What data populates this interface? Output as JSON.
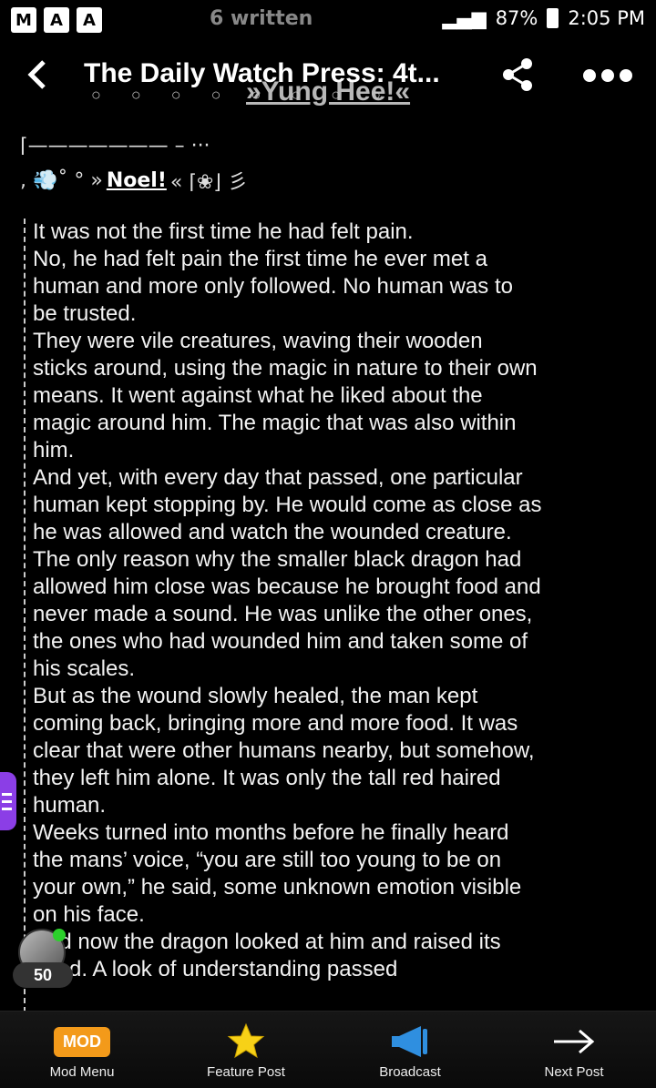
{
  "statusbar": {
    "center_text": "6 written",
    "battery": "87%",
    "time": "2:05 PM"
  },
  "header": {
    "title": "The Daily Watch Press: 4t...",
    "overlay_text": "»Yung Hee!«",
    "circles": "○ ○ ○ ○ ○ ○ ○ ○"
  },
  "content": {
    "deco_line1": "⌈——————— – ···",
    "deco_prefix": ", 💨˚ ° »",
    "deco_name": "Noel!",
    "deco_suffix": "« ⌈❀⌋ 彡",
    "paragraphs": [
      "It was not the first time he had felt pain.",
      "No, he had felt pain the first time he ever met a human and more only followed. No human was to be trusted.",
      "They were vile creatures, waving their wooden sticks around, using the magic in nature to their own means. It went against what he liked about the magic around him. The magic that was also within him.",
      "And yet, with every day that passed, one particular human kept stopping by. He would come as close as he was allowed and watch the wounded creature.",
      "The only reason why the smaller black dragon had allowed him close was because he brought food and never made a sound. He was unlike the other ones, the ones who had wounded him and taken some of his scales.",
      "But as the wound slowly healed, the man kept coming back, bringing more and more food. It was clear that were other humans nearby, but somehow, they left him alone. It was only the tall red haired human.",
      "Weeks turned into months before he finally heard the mans’ voice, “you are still too young to be on your own,” he said, some unknown emotion visible on his face.",
      "And now the dragon looked at him and raised its head. A look of understanding passed"
    ]
  },
  "avatar": {
    "level": "50"
  },
  "bottombar": {
    "mod_badge": "MOD",
    "items": [
      {
        "label": "Mod Menu",
        "icon": "mod-badge-icon"
      },
      {
        "label": "Feature Post",
        "icon": "star-icon"
      },
      {
        "label": "Broadcast",
        "icon": "megaphone-icon"
      },
      {
        "label": "Next Post",
        "icon": "arrow-right-icon"
      }
    ]
  },
  "colors": {
    "mod_badge": "#f39a1a",
    "star": "#f7d117",
    "broadcast": "#2f8fe0",
    "side_tab": "#8b3ee6",
    "online": "#2bd12b"
  }
}
